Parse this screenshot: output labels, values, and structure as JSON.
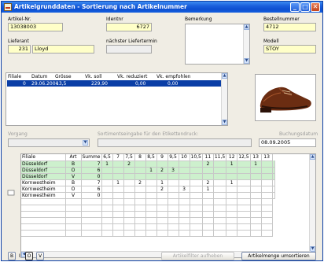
{
  "window": {
    "title": "Artikelgrunddaten - Sortierung nach Artikelnummer",
    "minimize": "_",
    "maximize": "□",
    "close": "✕"
  },
  "fields": {
    "artikelnr_label": "Artikel-Nr.",
    "artikelnr_value": "13038003",
    "identnr_label": "Identnr",
    "identnr_value": "6727",
    "bemerkung_label": "Bemerkung",
    "bestellnummer_label": "Bestellnummer",
    "bestellnummer_value": "4712",
    "lieferant_label": "Lieferant",
    "lieferant_nr": "231",
    "lieferant_name": "Lloyd",
    "naechster_liefertermin_label": "nächster Liefertermin",
    "naechster_liefertermin_value": "",
    "modell_label": "Modell",
    "modell_value": "STOY"
  },
  "sales": {
    "headers": [
      "Filiale",
      "Datum",
      "Grösse",
      "Vk. soll",
      "Vk. reduziert",
      "Vk. empfohlen"
    ],
    "rows": [
      {
        "filiale": "0",
        "datum": "29.06.2004",
        "groesse": "13,5",
        "vk_soll": "229,90",
        "vk_reduziert": "0,00",
        "vk_empfohlen": "0,00"
      }
    ]
  },
  "lower": {
    "vorgang_label": "Vorgang",
    "vorgang_value": "",
    "sortiment_label": "Sortimentseingabe für den Etikettendruck:",
    "sortiment_value": "",
    "buchungsdatum_label": "Buchungsdatum",
    "buchungsdatum_value": "08.09.2005"
  },
  "grid": {
    "columns": [
      "Filiale",
      "Art",
      "Summe",
      "6,5",
      "7",
      "7,5",
      "8",
      "8,5",
      "9",
      "9,5",
      "10",
      "10,5",
      "11",
      "11,5",
      "12",
      "12,5",
      "13",
      "13"
    ],
    "rows": [
      {
        "filiale": "Düsseldorf",
        "art": "B",
        "summe": "7",
        "sizes": [
          "1",
          "",
          "2",
          "",
          "",
          "",
          "",
          "",
          "",
          "2",
          "",
          "1",
          "",
          "1",
          "",
          ""
        ],
        "highlight": true
      },
      {
        "filiale": "Düsseldorf",
        "art": "O",
        "summe": "6",
        "sizes": [
          "",
          "",
          "",
          "",
          "1",
          "2",
          "3",
          "",
          "",
          "",
          "",
          "",
          "",
          "",
          "",
          ""
        ],
        "highlight": true
      },
      {
        "filiale": "Düsseldorf",
        "art": "V",
        "summe": "0",
        "sizes": [
          "",
          "",
          "",
          "",
          "",
          "",
          "",
          "",
          "",
          "",
          "",
          "",
          "",
          "",
          "",
          ""
        ],
        "highlight": true
      },
      {
        "filiale": "Kornwestheim",
        "art": "B",
        "summe": "7",
        "sizes": [
          "",
          "1",
          "",
          "2",
          "",
          "1",
          "",
          "",
          "",
          "2",
          "",
          "1",
          "",
          "",
          "",
          ""
        ],
        "highlight": false
      },
      {
        "filiale": "Kornwestheim",
        "art": "O",
        "summe": "6",
        "sizes": [
          "",
          "",
          "",
          "",
          "",
          "2",
          "",
          "3",
          "",
          "1",
          "",
          "",
          "",
          "",
          "",
          ""
        ],
        "highlight": false
      },
      {
        "filiale": "Kornwestheim",
        "art": "V",
        "summe": "0",
        "sizes": [
          "",
          "",
          "",
          "",
          "",
          "",
          "",
          "",
          "",
          "",
          "",
          "",
          "",
          "",
          "",
          ""
        ],
        "highlight": false
      }
    ]
  },
  "bottom": {
    "btn_b": "B",
    "label_i": "I",
    "btn_o": "O",
    "btn_v": "V",
    "artikelfilter": "Artikelfilter aufheben",
    "artikelmenge": "Artikelmenge umsortieren"
  }
}
